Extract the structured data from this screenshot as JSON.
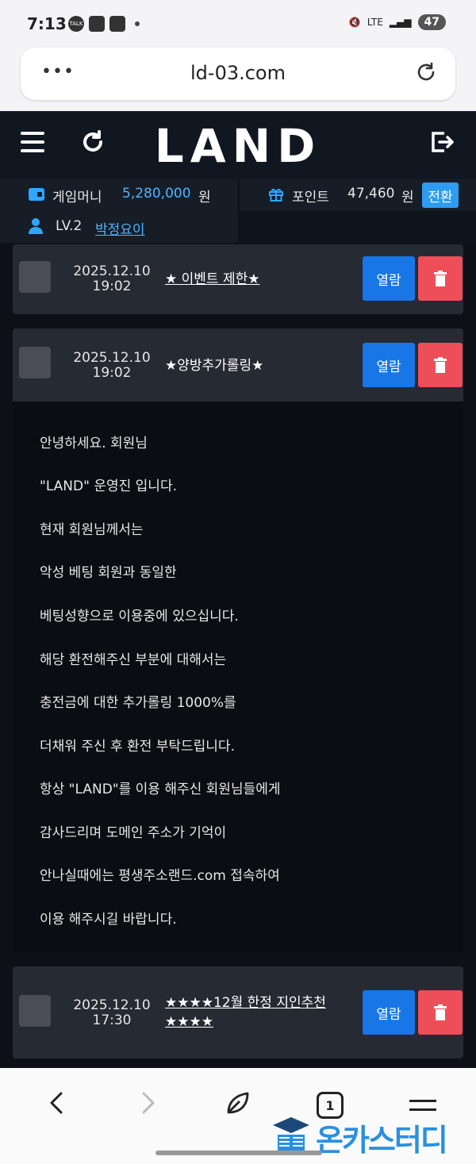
{
  "status_bar": {
    "time": "7:13",
    "battery": "47",
    "network": "LTE"
  },
  "browser": {
    "url": "ld-03.com",
    "menu_glyph": "•••",
    "tab_count": "1"
  },
  "header": {
    "logo": "LAND"
  },
  "account": {
    "money_label": "게임머니",
    "money_value": "5,280,000",
    "money_unit": "원",
    "point_label": "포인트",
    "point_value": "47,460",
    "point_unit": "원",
    "convert_label": "전환",
    "level": "LV.2",
    "nickname": "박정요이"
  },
  "messages": [
    {
      "date": "2025.12.10",
      "time": "19:02",
      "title": "★ 이벤트 제한★",
      "open_label": "열람"
    },
    {
      "date": "2025.12.10",
      "time": "19:02",
      "title": "★양방추가롤링★",
      "open_label": "열람"
    },
    {
      "date": "2025.12.10",
      "time": "17:30",
      "title": "★★★★12월 한정 지인추천★★★★",
      "open_label": "열람"
    }
  ],
  "message_body": [
    "안녕하세요. 회원님",
    "\"LAND\" 운영진 입니다.",
    "현재 회원님께서는",
    "악성 베팅 회원과 동일한",
    "베팅성향으로 이용중에 있으십니다.",
    "해당 환전해주신 부분에 대해서는",
    "충전금에 대한 추가롤링 1000%를",
    "더채워 주신 후 환전 부탁드립니다.",
    "항상 \"LAND\"를 이용 해주신 회원님들에게",
    "감사드리며 도메인 주소가 기억이",
    "안나실때에는 평생주소랜드.com 접속하여",
    "이용 해주시길 바랍니다."
  ],
  "watermark": {
    "text": "온카스터디"
  },
  "colors": {
    "accent_blue": "#4fb3ff",
    "open_button": "#1876e6",
    "delete_button": "#ee4e58",
    "background": "#0d1117"
  }
}
